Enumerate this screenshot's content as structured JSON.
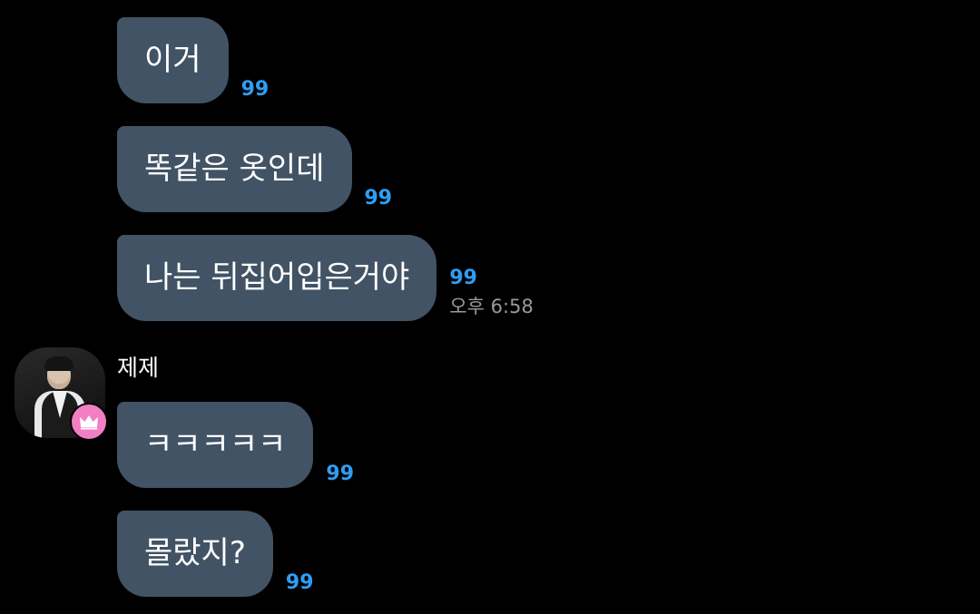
{
  "sender": {
    "name": "제제"
  },
  "my_messages": [
    {
      "text": "이거",
      "unread": "99"
    },
    {
      "text": "똑같은 옷인데",
      "unread": "99"
    },
    {
      "text": "나는 뒤집어입은거야",
      "unread": "99",
      "time": "오후 6:58"
    }
  ],
  "their_messages": [
    {
      "text": "ㅋㅋㅋㅋㅋ",
      "unread": "99"
    },
    {
      "text": "몰랐지?",
      "unread": "99"
    }
  ],
  "colors": {
    "background": "#000000",
    "bubble": "#415364",
    "unread_count": "#2e9df3",
    "timestamp": "#9a9a9a",
    "badge": "#f27fc4"
  },
  "icons": {
    "avatar_badge": "crown-icon"
  }
}
